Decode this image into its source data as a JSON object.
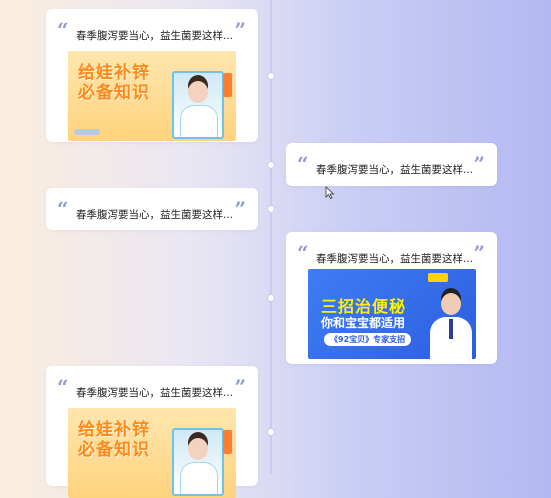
{
  "timeline": {
    "items": [
      {
        "side": "left",
        "title": "春季腹泻要当心，益生菌要这样...",
        "thumbnail": {
          "type": "warm",
          "headline_lines": [
            "给娃补锌",
            "必备知识"
          ]
        }
      },
      {
        "side": "right",
        "title": "春季腹泻要当心，益生菌要这样...",
        "thumbnail": null
      },
      {
        "side": "left",
        "title": "春季腹泻要当心，益生菌要这样...",
        "thumbnail": null
      },
      {
        "side": "right",
        "title": "春季腹泻要当心，益生菌要这样...",
        "thumbnail": {
          "type": "blue",
          "headline": "三招治便秘",
          "subheadline": "你和宝宝都适用",
          "pill": "《92宝贝》专家支招"
        }
      },
      {
        "side": "left",
        "title": "春季腹泻要当心，益生菌要这样...",
        "thumbnail": {
          "type": "warm",
          "headline_lines": [
            "给娃补锌",
            "必备知识"
          ]
        }
      }
    ]
  },
  "icons": {
    "quote_open": "“",
    "quote_close": "”",
    "cursor": "mouse-pointer-icon"
  },
  "colors": {
    "quote": "#8f9bd9",
    "timeline": "#c8ccef",
    "accent_orange": "#ff8a1c",
    "accent_blue": "#2c5fe0"
  }
}
